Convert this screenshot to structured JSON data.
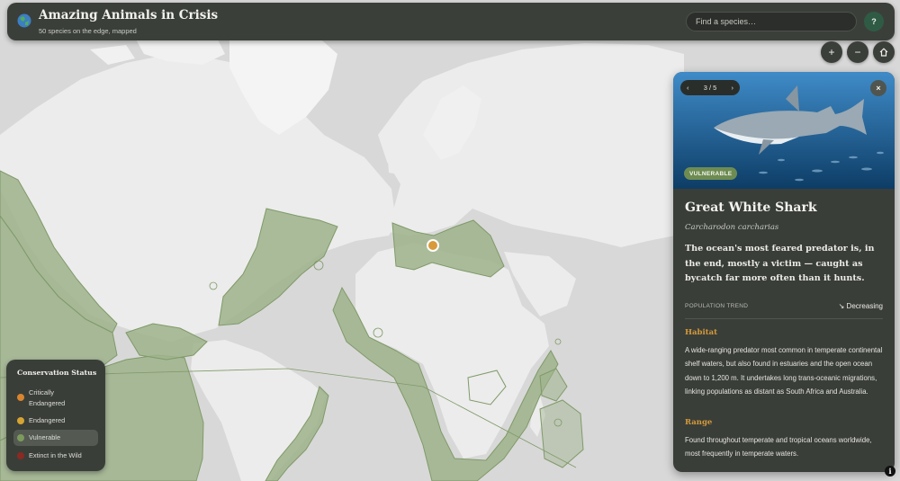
{
  "header": {
    "title": "Amazing Animals in Crisis",
    "subtitle": "50 species on the edge, mapped",
    "logo_icon": "globe-icon",
    "search_placeholder": "Find a species…",
    "help_label": "?"
  },
  "map_controls": {
    "zoom_in": "+",
    "zoom_out": "−",
    "home_icon": "home-icon"
  },
  "species_card": {
    "pager": {
      "prev": "‹",
      "label": "3 / 5",
      "next": "›"
    },
    "close_label": "×",
    "status": "VULNERABLE",
    "status_color": "#6e8c52",
    "common_name": "Great White Shark",
    "scientific_name": "Carcharodon carcharias",
    "lede": "The ocean's most feared predator is, in the end, mostly a victim — caught as bycatch far more often than it hunts.",
    "trend_label": "POPULATION TREND",
    "trend_value": "↘ Decreasing",
    "sections": [
      {
        "heading": "Habitat",
        "body": "A wide-ranging predator most common in temperate continental shelf waters, but also found in estuaries and the open ocean down to 1,200 m. It undertakes long trans-oceanic migrations, linking populations as distant as South Africa and Australia."
      },
      {
        "heading": "Range",
        "body": "Found throughout temperate and tropical oceans worldwide, most frequently in temperate waters."
      }
    ]
  },
  "legend": {
    "title": "Conservation Status",
    "items": [
      {
        "label": "Critically Endangered",
        "color": "#d9852f",
        "active": false
      },
      {
        "label": "Endangered",
        "color": "#d6a432",
        "active": false
      },
      {
        "label": "Vulnerable",
        "color": "#7d9a5d",
        "active": true
      },
      {
        "label": "Extinct in the Wild",
        "color": "#8a2a22",
        "active": false
      }
    ]
  },
  "colors": {
    "land": "#ececec",
    "ocean": "#d6d6d6",
    "range": "#9fb38c",
    "range_outline": "#7f9a68",
    "panel": "#3a3e39",
    "accent": "#d49a3a"
  },
  "attribution_icon": "info-icon"
}
